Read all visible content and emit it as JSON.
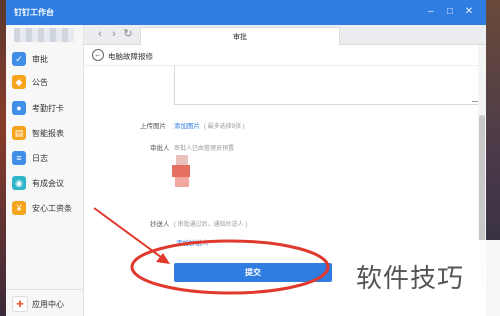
{
  "window": {
    "title": "钉钉工作台"
  },
  "sidebar": {
    "items": [
      {
        "label": "审批",
        "icon": "approval-icon",
        "color": "#3f8ee8"
      },
      {
        "label": "公告",
        "icon": "announcement-icon",
        "color": "#f4a51c"
      },
      {
        "label": "考勤打卡",
        "icon": "location-pin-icon",
        "color": "#3f8ee8"
      },
      {
        "label": "智能报表",
        "icon": "report-icon",
        "color": "#f4a51c"
      },
      {
        "label": "日志",
        "icon": "log-icon",
        "color": "#3f8ee8"
      },
      {
        "label": "有成会议",
        "icon": "meeting-icon",
        "color": "#2fb5c9"
      },
      {
        "label": "安心工资条",
        "icon": "payslip-icon",
        "color": "#f4a51c"
      }
    ],
    "bottom": {
      "label": "应用中心",
      "icon": "app-center-icon"
    }
  },
  "tabbar": {
    "tab_label": "审批"
  },
  "page": {
    "title": "电脑故障报修"
  },
  "form": {
    "upload_label": "上传图片",
    "upload_link": "添加图片",
    "upload_hint": "( 最多选择9张 )",
    "approver_label": "审批人",
    "approver_hint": "审批人已由管理员预置",
    "cc_label": "抄送人",
    "cc_hint": "( 审批通过后，通知抄送人 )",
    "cc_link": "添加抄送人",
    "submit_label": "提交"
  },
  "watermark": "软件技巧",
  "colors": {
    "brand": "#2f7de1",
    "annotation": "#e03a2f"
  }
}
